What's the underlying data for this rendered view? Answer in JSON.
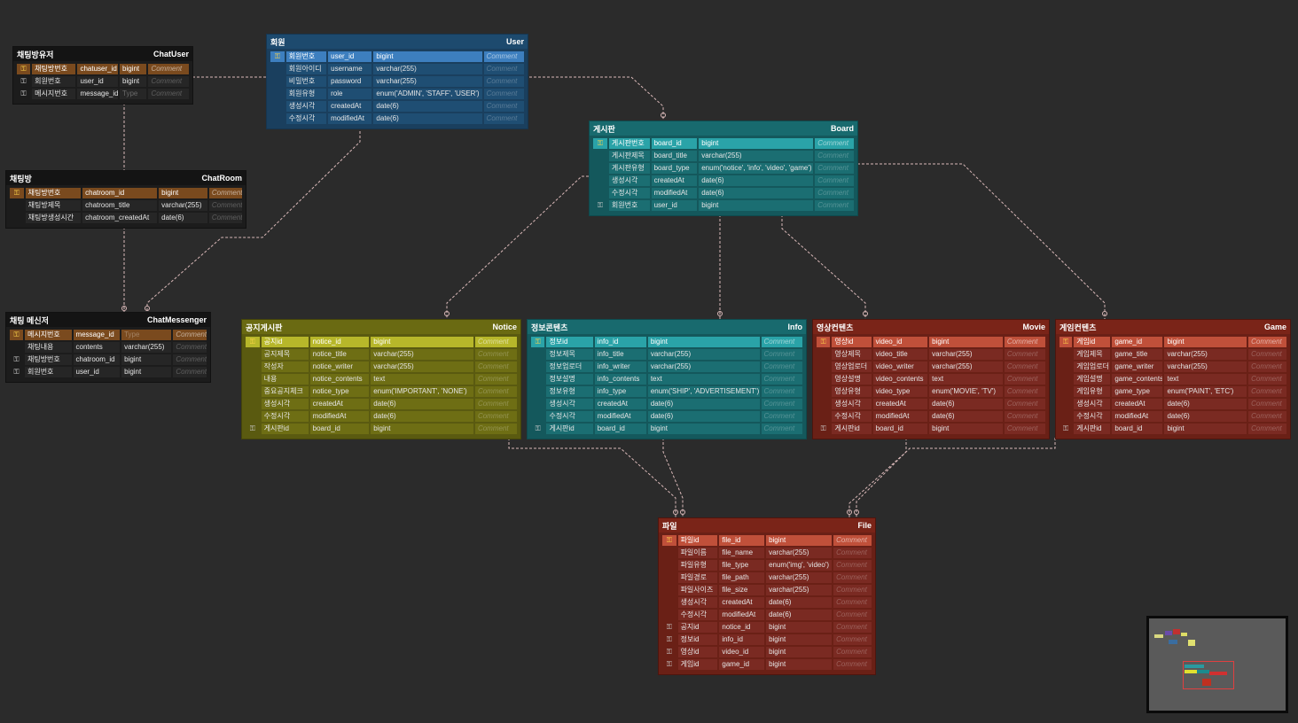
{
  "colors": {
    "black": "#141414",
    "blue": "#1f4e73",
    "teal": "#1b6e72",
    "olive": "#6e6e14",
    "red": "#7a2a22"
  },
  "tables": [
    {
      "id": "chatuser",
      "korean": "채팅방유저",
      "name": "ChatUser",
      "theme": "black",
      "rows": [
        {
          "key": "fk-pk",
          "ko": "채팅방번호",
          "col": "chatuser_id",
          "type": "bigint",
          "comment": "Comment",
          "pk": true
        },
        {
          "key": "fk",
          "ko": "회원번호",
          "col": "user_id",
          "type": "bigint",
          "comment": "Comment"
        },
        {
          "key": "fk",
          "ko": "메시지번호",
          "col": "message_id",
          "type": "Type",
          "comment": "Comment"
        }
      ]
    },
    {
      "id": "user",
      "korean": "회원",
      "name": "User",
      "theme": "blue",
      "rows": [
        {
          "key": "pk",
          "ko": "회원번호",
          "col": "user_id",
          "type": "bigint",
          "comment": "Comment",
          "pk": true
        },
        {
          "key": "",
          "ko": "회원아이디",
          "col": "username",
          "type": "varchar(255)",
          "comment": "Comment"
        },
        {
          "key": "",
          "ko": "비밀번호",
          "col": "password",
          "type": "varchar(255)",
          "comment": "Comment"
        },
        {
          "key": "",
          "ko": "회원유형",
          "col": "role",
          "type": "enum('ADMIN', 'STAFF', 'USER')",
          "comment": "Comment"
        },
        {
          "key": "",
          "ko": "생성시각",
          "col": "createdAt",
          "type": "date(6)",
          "comment": "Comment"
        },
        {
          "key": "",
          "ko": "수정시각",
          "col": "modifiedAt",
          "type": "date(6)",
          "comment": "Comment"
        }
      ]
    },
    {
      "id": "board",
      "korean": "게시판",
      "name": "Board",
      "theme": "teal",
      "rows": [
        {
          "key": "pk",
          "ko": "게시판번호",
          "col": "board_id",
          "type": "bigint",
          "comment": "Comment",
          "pk": true
        },
        {
          "key": "",
          "ko": "게시판제목",
          "col": "board_title",
          "type": "varchar(255)",
          "comment": "Comment"
        },
        {
          "key": "",
          "ko": "게시판유형",
          "col": "board_type",
          "type": "enum('notice', 'info', 'video', 'game')",
          "comment": "Comment"
        },
        {
          "key": "",
          "ko": "생성시각",
          "col": "createdAt",
          "type": "date(6)",
          "comment": "Comment"
        },
        {
          "key": "",
          "ko": "수정시각",
          "col": "modifiedAt",
          "type": "date(6)",
          "comment": "Comment"
        },
        {
          "key": "fk",
          "ko": "회원번호",
          "col": "user_id",
          "type": "bigint",
          "comment": "Comment"
        }
      ]
    },
    {
      "id": "chatroom",
      "korean": "채팅방",
      "name": "ChatRoom",
      "theme": "black",
      "rows": [
        {
          "key": "pk",
          "ko": "채팅방번호",
          "col": "chatroom_id",
          "type": "bigint",
          "comment": "Comment",
          "pk": true
        },
        {
          "key": "",
          "ko": "채팅방제목",
          "col": "chatroom_title",
          "type": "varchar(255)",
          "comment": "Comment"
        },
        {
          "key": "",
          "ko": "채팅방생성시간",
          "col": "chatroom_createdAt",
          "type": "date(6)",
          "comment": "Comment"
        }
      ]
    },
    {
      "id": "chatmessenger",
      "korean": "채팅 메신저",
      "name": "ChatMessenger",
      "theme": "black",
      "rows": [
        {
          "key": "pk",
          "ko": "메시지번호",
          "col": "message_id",
          "type": "Type",
          "comment": "Comment",
          "pk": true
        },
        {
          "key": "",
          "ko": "채팅내용",
          "col": "contents",
          "type": "varchar(255)",
          "comment": "Comment"
        },
        {
          "key": "fk",
          "ko": "채팅방번호",
          "col": "chatroom_id",
          "type": "bigint",
          "comment": "Comment"
        },
        {
          "key": "fk",
          "ko": "회원번호",
          "col": "user_id",
          "type": "bigint",
          "comment": "Comment"
        }
      ]
    },
    {
      "id": "notice",
      "korean": "공지게시판",
      "name": "Notice",
      "theme": "olive",
      "rows": [
        {
          "key": "pk",
          "ko": "공지id",
          "col": "notice_id",
          "type": "bigint",
          "comment": "Comment",
          "pk": true
        },
        {
          "key": "",
          "ko": "공지제목",
          "col": "notice_title",
          "type": "varchar(255)",
          "comment": "Comment"
        },
        {
          "key": "",
          "ko": "작성자",
          "col": "notice_writer",
          "type": "varchar(255)",
          "comment": "Comment"
        },
        {
          "key": "",
          "ko": "내용",
          "col": "notice_contents",
          "type": "text",
          "comment": "Comment"
        },
        {
          "key": "",
          "ko": "중요공지체크",
          "col": "notice_type",
          "type": "enum('IMPORTANT', 'NONE')",
          "comment": "Comment"
        },
        {
          "key": "",
          "ko": "생성시각",
          "col": "createdAt",
          "type": "date(6)",
          "comment": "Comment"
        },
        {
          "key": "",
          "ko": "수정시각",
          "col": "modifiedAt",
          "type": "date(6)",
          "comment": "Comment"
        },
        {
          "key": "fk",
          "ko": "게시판id",
          "col": "board_id",
          "type": "bigint",
          "comment": "Comment"
        }
      ]
    },
    {
      "id": "info",
      "korean": "정보콘텐츠",
      "name": "Info",
      "theme": "teal",
      "rows": [
        {
          "key": "pk",
          "ko": "정보id",
          "col": "info_id",
          "type": "bigint",
          "comment": "Comment",
          "pk": true
        },
        {
          "key": "",
          "ko": "정보제목",
          "col": "info_title",
          "type": "varchar(255)",
          "comment": "Comment"
        },
        {
          "key": "",
          "ko": "정보업로더",
          "col": "info_writer",
          "type": "varchar(255)",
          "comment": "Comment"
        },
        {
          "key": "",
          "ko": "정보설명",
          "col": "info_contents",
          "type": "text",
          "comment": "Comment"
        },
        {
          "key": "",
          "ko": "정보유형",
          "col": "info_type",
          "type": "enum('SHIP', 'ADVERTISEMENT')",
          "comment": "Comment"
        },
        {
          "key": "",
          "ko": "생성시각",
          "col": "createdAt",
          "type": "date(6)",
          "comment": "Comment"
        },
        {
          "key": "",
          "ko": "수정시각",
          "col": "modifiedAt",
          "type": "date(6)",
          "comment": "Comment"
        },
        {
          "key": "fk",
          "ko": "게시판id",
          "col": "board_id",
          "type": "bigint",
          "comment": "Comment"
        }
      ]
    },
    {
      "id": "movie",
      "korean": "영상컨텐츠",
      "name": "Movie",
      "theme": "red",
      "rows": [
        {
          "key": "pk",
          "ko": "영상id",
          "col": "video_id",
          "type": "bigint",
          "comment": "Comment",
          "pk": true
        },
        {
          "key": "",
          "ko": "영상제목",
          "col": "video_title",
          "type": "varchar(255)",
          "comment": "Comment"
        },
        {
          "key": "",
          "ko": "영상업로더",
          "col": "video_writer",
          "type": "varchar(255)",
          "comment": "Comment"
        },
        {
          "key": "",
          "ko": "영상설명",
          "col": "video_contents",
          "type": "text",
          "comment": "Comment"
        },
        {
          "key": "",
          "ko": "영상유형",
          "col": "video_type",
          "type": "enum('MOVIE', 'TV')",
          "comment": "Comment"
        },
        {
          "key": "",
          "ko": "생성시각",
          "col": "createdAt",
          "type": "date(6)",
          "comment": "Comment"
        },
        {
          "key": "",
          "ko": "수정시각",
          "col": "modifiedAt",
          "type": "date(6)",
          "comment": "Comment"
        },
        {
          "key": "fk",
          "ko": "게시판id",
          "col": "board_id",
          "type": "bigint",
          "comment": "Comment"
        }
      ]
    },
    {
      "id": "game",
      "korean": "게임컨텐츠",
      "name": "Game",
      "theme": "red",
      "rows": [
        {
          "key": "pk",
          "ko": "게임id",
          "col": "game_id",
          "type": "bigint",
          "comment": "Comment",
          "pk": true
        },
        {
          "key": "",
          "ko": "게임제목",
          "col": "game_title",
          "type": "varchar(255)",
          "comment": "Comment"
        },
        {
          "key": "",
          "ko": "게임업로더",
          "col": "game_writer",
          "type": "varchar(255)",
          "comment": "Comment"
        },
        {
          "key": "",
          "ko": "게임설명",
          "col": "game_contents",
          "type": "text",
          "comment": "Comment"
        },
        {
          "key": "",
          "ko": "게임유형",
          "col": "game_type",
          "type": "enum('PAINT', 'ETC')",
          "comment": "Comment"
        },
        {
          "key": "",
          "ko": "생성시각",
          "col": "createdAt",
          "type": "date(6)",
          "comment": "Comment"
        },
        {
          "key": "",
          "ko": "수정시각",
          "col": "modifiedAt",
          "type": "date(6)",
          "comment": "Comment"
        },
        {
          "key": "fk",
          "ko": "게시판id",
          "col": "board_id",
          "type": "bigint",
          "comment": "Comment"
        }
      ]
    },
    {
      "id": "file",
      "korean": "파일",
      "name": "File",
      "theme": "red",
      "rows": [
        {
          "key": "pk",
          "ko": "파일id",
          "col": "file_id",
          "type": "bigint",
          "comment": "Comment",
          "pk": true
        },
        {
          "key": "",
          "ko": "파일이름",
          "col": "file_name",
          "type": "varchar(255)",
          "comment": "Comment"
        },
        {
          "key": "",
          "ko": "파일유형",
          "col": "file_type",
          "type": "enum('img', 'video')",
          "comment": "Comment"
        },
        {
          "key": "",
          "ko": "파일경로",
          "col": "file_path",
          "type": "varchar(255)",
          "comment": "Comment"
        },
        {
          "key": "",
          "ko": "파일사이즈",
          "col": "file_size",
          "type": "varchar(255)",
          "comment": "Comment"
        },
        {
          "key": "",
          "ko": "생성시각",
          "col": "createdAt",
          "type": "date(6)",
          "comment": "Comment"
        },
        {
          "key": "",
          "ko": "수정시각",
          "col": "modifiedAt",
          "type": "date(6)",
          "comment": "Comment"
        },
        {
          "key": "fk",
          "ko": "공지id",
          "col": "notice_id",
          "type": "bigint",
          "comment": "Comment"
        },
        {
          "key": "fk",
          "ko": "정보id",
          "col": "info_id",
          "type": "bigint",
          "comment": "Comment"
        },
        {
          "key": "fk",
          "ko": "영상id",
          "col": "video_id",
          "type": "bigint",
          "comment": "Comment"
        },
        {
          "key": "fk",
          "ko": "게임id",
          "col": "game_id",
          "type": "bigint",
          "comment": "Comment"
        }
      ]
    }
  ],
  "relationships": [
    {
      "from": "user",
      "to": "chatuser"
    },
    {
      "from": "user",
      "to": "board"
    },
    {
      "from": "user",
      "to": "chatmessenger"
    },
    {
      "from": "chatuser",
      "to": "chatroom"
    },
    {
      "from": "chatroom",
      "to": "chatmessenger"
    },
    {
      "from": "board",
      "to": "notice"
    },
    {
      "from": "board",
      "to": "info"
    },
    {
      "from": "board",
      "to": "movie"
    },
    {
      "from": "board",
      "to": "game"
    },
    {
      "from": "notice",
      "to": "file"
    },
    {
      "from": "info",
      "to": "file"
    },
    {
      "from": "movie",
      "to": "file"
    },
    {
      "from": "game",
      "to": "file"
    }
  ],
  "minimap": {
    "label": "minimap"
  }
}
